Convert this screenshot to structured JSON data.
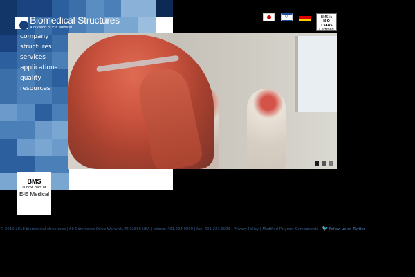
{
  "header": {
    "logo_name": "Biomedical Structures",
    "logo_sub": "A division of E²E Medical"
  },
  "nav": {
    "items": [
      "company",
      "structures",
      "services",
      "applications",
      "quality",
      "resources"
    ]
  },
  "flags": [
    "japan-flag-icon",
    "israel-flag-icon",
    "germany-flag-icon"
  ],
  "iso_badge": {
    "line1": "BMS is",
    "line2": "ISO 13485",
    "line3": "Certified"
  },
  "badge": {
    "line1": "BMS",
    "line2": "is now part of",
    "line3": "E²E Medical"
  },
  "slider": {
    "dots": 3,
    "active_index": 0,
    "colors": [
      "#1a1a1a",
      "#555555",
      "#777777"
    ]
  },
  "footer": {
    "text": "© 2010-2018 biomedical structures | 60 Commerce Drive Warwick, RI 02886 USA | phone: 401.223.0990 | fax: 401.223.0993 |",
    "privacy": "Privacy Policy",
    "sep": "|",
    "modified": "Modified Polymer Components",
    "twitter": "Follow us on Twitter"
  },
  "colors": {
    "brand_blue": "#1a3f78",
    "footer_link": "#3a5e8a"
  }
}
